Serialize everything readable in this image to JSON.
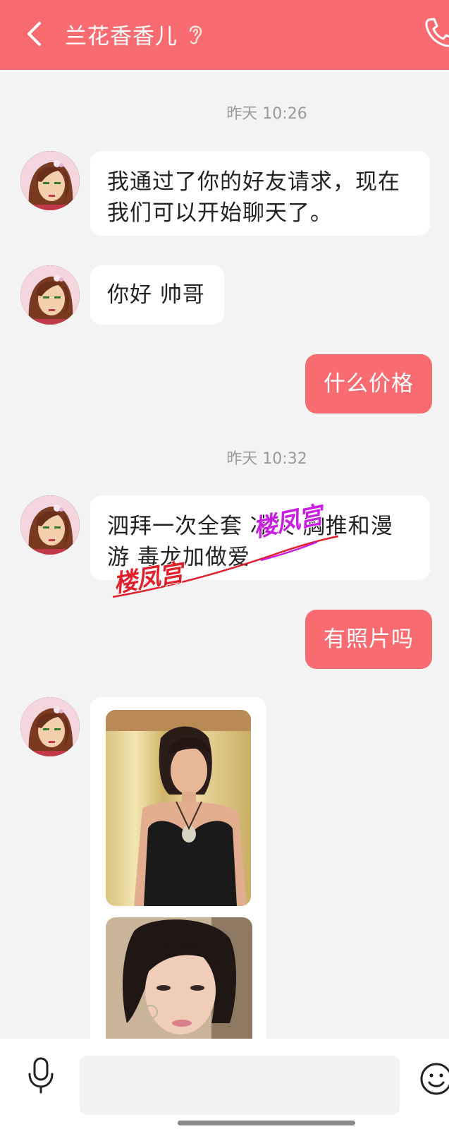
{
  "header": {
    "title": "兰花香香儿",
    "back_icon": "chevron-left-icon",
    "ear_icon": "ear-icon",
    "call_icon": "phone-icon",
    "background_color": "#f86b70"
  },
  "messages": [
    {
      "type": "timestamp",
      "text": "昨天 10:26"
    },
    {
      "type": "incoming",
      "text": "我通过了你的好友请求，现在我们可以开始聊天了。"
    },
    {
      "type": "incoming",
      "text": "你好 帅哥"
    },
    {
      "type": "outgoing",
      "text": "什么价格"
    },
    {
      "type": "timestamp",
      "text": "昨天 10:32"
    },
    {
      "type": "incoming",
      "text": "泗拜一次全套  冰火 胸推和漫游 毒龙加做爱"
    },
    {
      "type": "outgoing",
      "text": "有照片吗"
    },
    {
      "type": "incoming_images",
      "count": 2
    }
  ],
  "watermark": {
    "text": "楼凤宫",
    "colors": [
      "#c81ee0",
      "#e0202a"
    ]
  },
  "footer": {
    "mic_icon": "microphone-icon",
    "input_value": "",
    "emoji_icon": "smiley-icon"
  },
  "colors": {
    "accent": "#f86b70",
    "background": "#f3f3f3",
    "bubble_in": "#ffffff",
    "timestamp": "#9a9a9a"
  }
}
